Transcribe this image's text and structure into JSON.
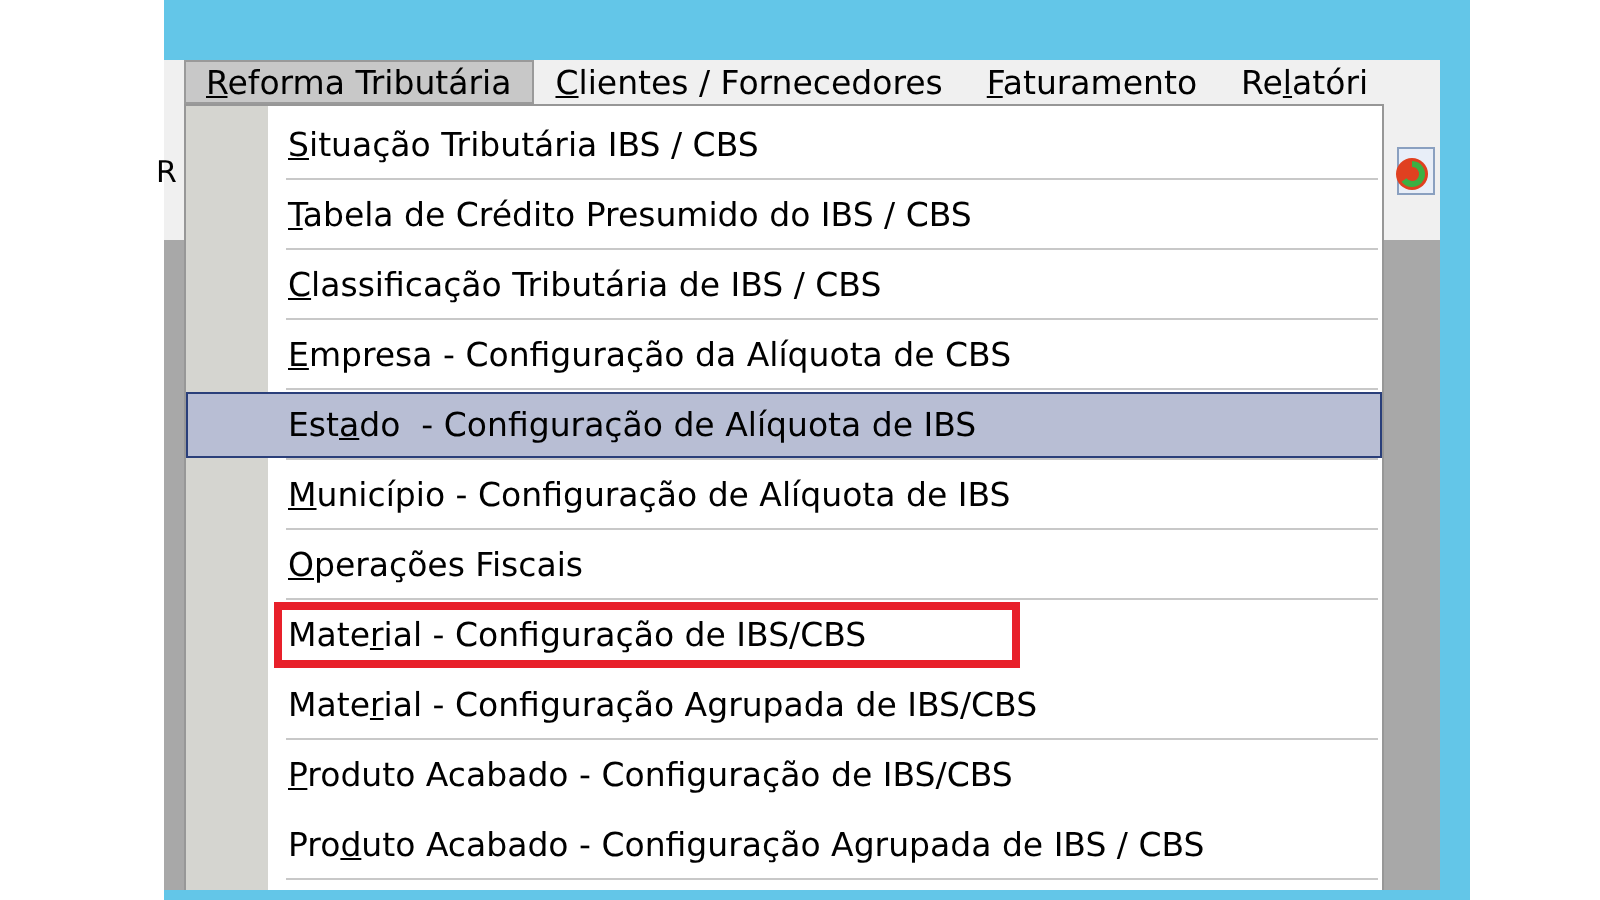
{
  "menu_bar": [
    {
      "text": {
        "key": "R",
        "after": "eforma Tributária"
      },
      "selected": true
    },
    {
      "text": {
        "key": "C",
        "after": "lientes / Fornecedores"
      },
      "selected": false
    },
    {
      "text": {
        "key": "F",
        "after": "aturamento"
      },
      "selected": false
    },
    {
      "text": {
        "before": "Re",
        "key": "l",
        "after": "atóri"
      },
      "selected": false
    }
  ],
  "toolbar": {
    "partial_text": "R"
  },
  "menu": {
    "items": [
      {
        "text": {
          "key": "S",
          "after": "ituação Tributária IBS / CBS"
        },
        "selected": false,
        "annotated": false,
        "divider_below": true
      },
      {
        "text": {
          "key": "T",
          "after": "abela de Crédito Presumido do IBS / CBS"
        },
        "selected": false,
        "annotated": false,
        "divider_below": true
      },
      {
        "text": {
          "key": "C",
          "after": "lassificação Tributária de IBS / CBS"
        },
        "selected": false,
        "annotated": false,
        "divider_below": true
      },
      {
        "text": {
          "key": "E",
          "after": "mpresa - Configuração da Alíquota de CBS"
        },
        "selected": false,
        "annotated": false,
        "divider_below": true
      },
      {
        "text": {
          "before": "Est",
          "key": "a",
          "after": "do  - Configuração de Alíquota de IBS"
        },
        "selected": true,
        "annotated": false,
        "divider_below": true
      },
      {
        "text": {
          "key": "M",
          "after": "unicípio - Configuração de Alíquota de IBS"
        },
        "selected": false,
        "annotated": false,
        "divider_below": true
      },
      {
        "text": {
          "key": "O",
          "after": "perações Fiscais"
        },
        "selected": false,
        "annotated": false,
        "divider_below": true
      },
      {
        "text": {
          "before": "Mate",
          "key": "r",
          "after": "ial - Configuração de IBS/CBS"
        },
        "selected": false,
        "annotated": true,
        "divider_below": false
      },
      {
        "text": {
          "before": "Mate",
          "key": "r",
          "after": "ial - Configuração Agrupada de IBS/CBS"
        },
        "selected": false,
        "annotated": false,
        "divider_below": true
      },
      {
        "text": {
          "key": "P",
          "after": "roduto Acabado - Configuração de IBS/CBS"
        },
        "selected": false,
        "annotated": false,
        "divider_below": false
      },
      {
        "text": {
          "before": "Pro",
          "key": "d",
          "after": "uto Acabado - Configuração Agrupada de IBS / CBS"
        },
        "selected": false,
        "annotated": false,
        "divider_below": true
      }
    ]
  }
}
